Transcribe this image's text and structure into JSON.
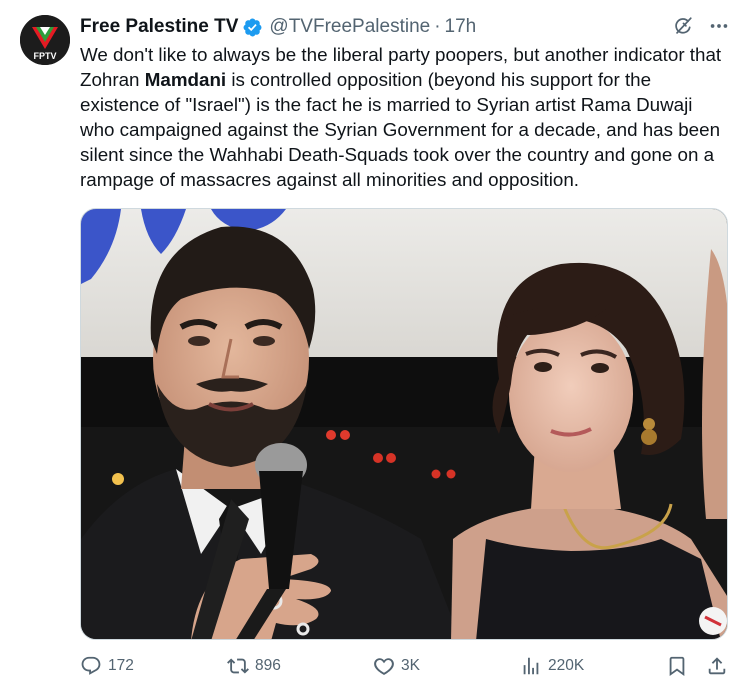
{
  "author": {
    "display_name": "Free Palestine TV",
    "handle": "@TVFreePalestine",
    "separator": "·",
    "time": "17h",
    "avatar_text": "FPTV",
    "verified": true
  },
  "tweet": {
    "text_before": "We don't like to always be the liberal party poopers, but another indicator that Zohran ",
    "text_bold": "Mamdani",
    "text_after": " is controlled opposition (beyond his support for the existence of \"Israel\") is the fact he is married to Syrian artist Rama Duwaji who campaigned against the Syrian Government for a decade, and has been silent since the Wahhabi Death-Squads took over the country and gone on a rampage of massacres against all minorities and opposition."
  },
  "top_actions": {
    "grok_icon": "grok-icon",
    "more_icon": "more-icon"
  },
  "metrics": {
    "replies": "172",
    "reposts": "896",
    "likes": "3K",
    "views": "220K"
  },
  "colors": {
    "text": "#0f1419",
    "secondary": "#536471",
    "verified": "#1d9bf0",
    "border": "#cfd9de"
  }
}
